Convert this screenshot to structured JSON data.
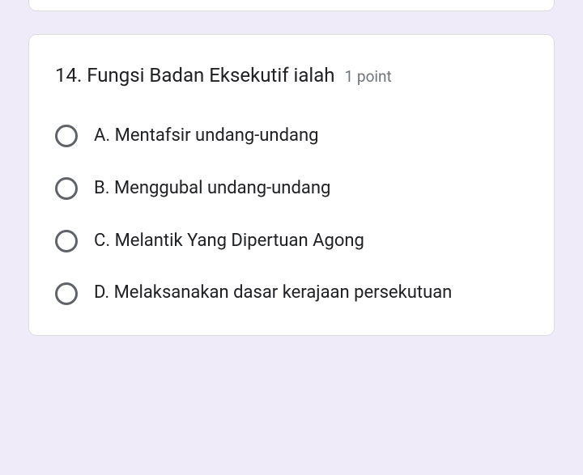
{
  "question": {
    "title": "14. Fungsi Badan Eksekutif ialah",
    "points": "1 point",
    "options": [
      "A. Mentafsir undang-undang",
      "B. Menggubal undang-undang",
      "C. Melantik Yang Dipertuan Agong",
      "D. Melaksanakan dasar kerajaan persekutuan"
    ]
  }
}
